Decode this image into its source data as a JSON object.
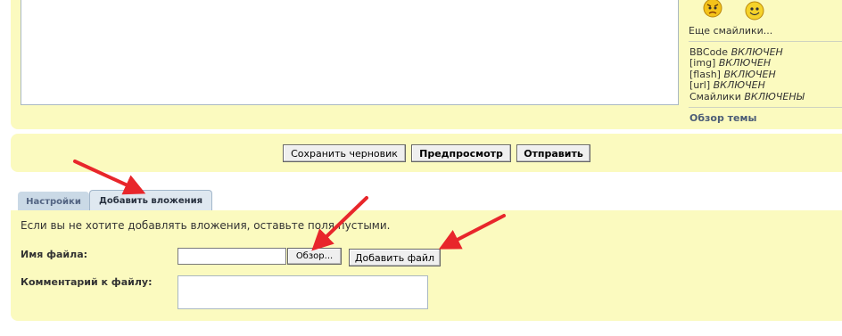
{
  "editor": {
    "smilies_more": "Еще смайлики...",
    "options": {
      "bbcode_label": "BBCode",
      "bbcode_state": "ВКЛЮЧЕН",
      "img_label": "[img]",
      "img_state": "ВКЛЮЧЕН",
      "flash_label": "[flash]",
      "flash_state": "ВКЛЮЧЕН",
      "url_label": "[url]",
      "url_state": "ВКЛЮЧЕН",
      "smilies_label": "Смайлики",
      "smilies_state": "ВКЛЮЧЕНЫ"
    },
    "topic_review": "Обзор темы"
  },
  "actions": {
    "save_draft": "Сохранить черновик",
    "preview": "Предпросмотр",
    "submit": "Отправить"
  },
  "tabs": [
    {
      "label": "Настройки"
    },
    {
      "label": "Добавить вложения"
    }
  ],
  "attachments": {
    "note": "Если вы не хотите добавлять вложения, оставьте поля пустыми.",
    "filename_label": "Имя файла:",
    "browse_button": "Обзор...",
    "add_file_button": "Добавить файл",
    "comment_label": "Комментарий к файлу:"
  },
  "colors": {
    "panel_bg": "#fbfabf",
    "arrow": "#e8262b"
  }
}
